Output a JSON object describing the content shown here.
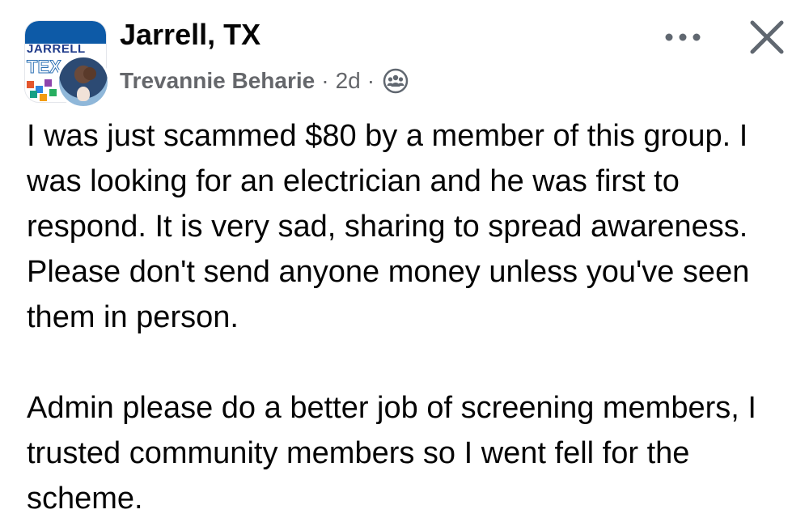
{
  "post": {
    "group_name": "Jarrell, TX",
    "group_avatar": {
      "logo_line1": "JARRELL",
      "logo_line2": "TEX"
    },
    "author": "Trevannie Beharie",
    "separator": "·",
    "timestamp": "2d",
    "audience_icon": "group-members-icon",
    "more_icon": "more-options-icon",
    "close_icon": "close-icon",
    "body": {
      "paragraph1": "I was just scammed $80 by a member of this group. I was looking for an electrician and he was first to respond. It is very sad, sharing to spread awareness. Please don't send anyone money unless you've seen them in person.",
      "paragraph2": "Admin please do a better job of screening members, I trusted community members so I went fell for the scheme."
    }
  },
  "colors": {
    "primary_text": "#050505",
    "secondary_text": "#65676b",
    "icon": "#606770",
    "background": "#ffffff"
  }
}
